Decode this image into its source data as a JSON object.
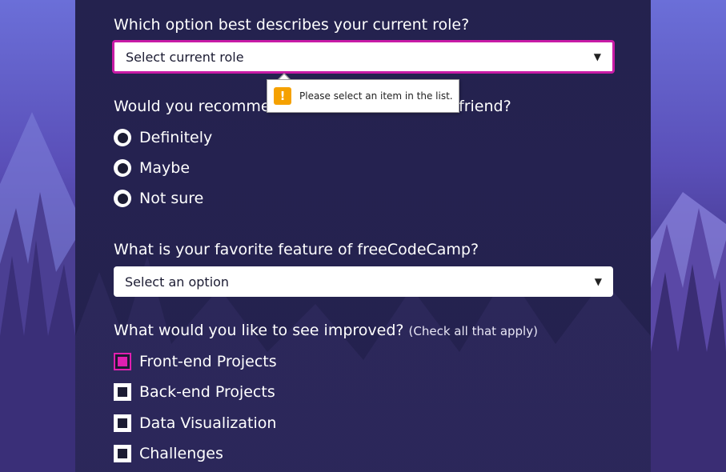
{
  "colors": {
    "panel": "#24214e",
    "accent": "#c81ba6",
    "checked": "#e01fb0",
    "warning": "#f5a100"
  },
  "role_question": {
    "label": "Which option best describes your current role?",
    "select_value": "Select current role"
  },
  "tooltip": {
    "icon": "warning-icon",
    "message": "Please select an item in the list."
  },
  "recommend_question": {
    "label_visible_start": "Would you recomme",
    "label_visible_end": "friend?",
    "options": [
      "Definitely",
      "Maybe",
      "Not sure"
    ]
  },
  "feature_question": {
    "label": "What is your favorite feature of freeCodeCamp?",
    "select_value": "Select an option"
  },
  "improve_question": {
    "label": "What would you like to see improved?",
    "note": "(Check all that apply)",
    "options": [
      "Front-end Projects",
      "Back-end Projects",
      "Data Visualization",
      "Challenges"
    ],
    "checked": [
      true,
      false,
      false,
      false
    ]
  }
}
